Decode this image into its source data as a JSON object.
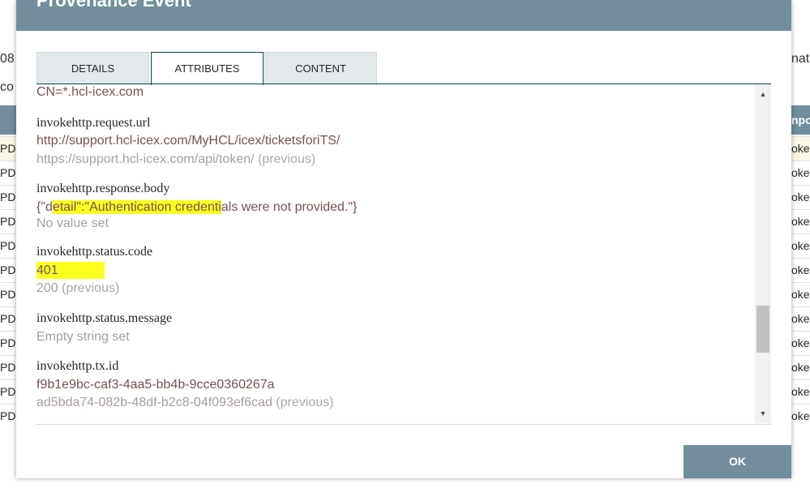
{
  "dialog": {
    "title": "Provenance Event",
    "tabs": [
      {
        "label": "DETAILS"
      },
      {
        "label": "ATTRIBUTES"
      },
      {
        "label": "CONTENT"
      }
    ],
    "active_tab": "ATTRIBUTES",
    "ok_label": "OK"
  },
  "attributes": {
    "top_value": "CN=*.hcl-icex.com",
    "request_url": {
      "name": "invokehttp.request.url",
      "value": "http://support.hcl-icex.com/MyHCL/icex/ticketsforiTS/",
      "previous": "https://support.hcl-icex.com/api/token/",
      "previous_label": "(previous)"
    },
    "response_body": {
      "name": "invokehttp.response.body",
      "value_a": "{\"d",
      "value_hl": "etail\":\"Authentication credenti",
      "value_b": "als were not provided.\"}",
      "previous": "No value set"
    },
    "status_code": {
      "name": "invokehttp.status.code",
      "value": "401",
      "previous": "200",
      "previous_label": "(previous)"
    },
    "status_message": {
      "name": "invokehttp.status.message",
      "previous": "Empty string set"
    },
    "tx_id": {
      "name": "invokehttp.tx.id",
      "value": "f9b1e9bc-caf3-4aa5-bb4b-9cce0360267a",
      "previous": "ad5bda74-082b-48df-b2c8-04f093ef6cad",
      "previous_label": "(previous)"
    }
  },
  "background": {
    "left_top_text": "08",
    "left_row_text": "co",
    "right_top_text": "nato",
    "header_right_text": "npor",
    "left_cells": [
      "PDT",
      "PDT",
      "PDT",
      "PDT",
      "PDT",
      "PDT",
      "PDT",
      "PDT",
      "PDT",
      "PDT",
      "PDT",
      "PDT"
    ],
    "right_cells": [
      "oke",
      "oke",
      "oke",
      "oke",
      "oke",
      "oke",
      "oke",
      "oke",
      "oke",
      "oke",
      "oke",
      "oke"
    ]
  }
}
